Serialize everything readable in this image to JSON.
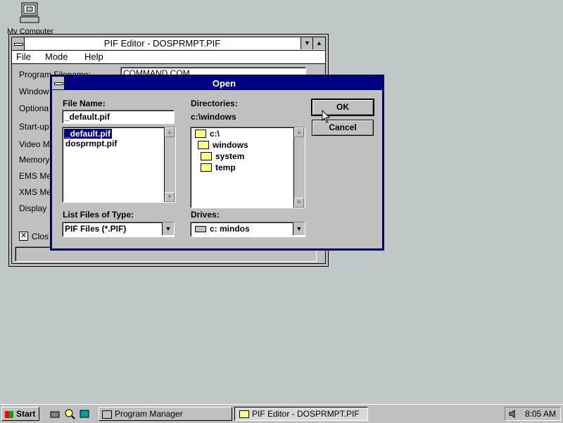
{
  "desktop": {
    "icon_label": "My Computer"
  },
  "pif_window": {
    "title": "PIF Editor - DOSPRMPT.PIF",
    "menu": [
      "File",
      "Mode",
      "Help"
    ],
    "fields": [
      {
        "label": "Program Filename:",
        "value": "COMMAND.COM"
      },
      {
        "label": "Window"
      },
      {
        "label": "Optiona"
      },
      {
        "label": "Start-up"
      },
      {
        "label": "Video M"
      },
      {
        "label": "Memory"
      },
      {
        "label": "EMS Me"
      },
      {
        "label": "XMS Me"
      },
      {
        "label": "Display"
      }
    ],
    "close_checkbox_label": "Clos"
  },
  "open_dialog": {
    "title": "Open",
    "file_name_label": "File Name:",
    "file_name_value": "_default.pif",
    "files": [
      "_default.pif",
      "dosprmpt.pif"
    ],
    "selected_file": "_default.pif",
    "directories_label": "Directories:",
    "current_dir": "c:\\windows",
    "dir_tree": [
      "c:\\",
      "windows",
      "system",
      "temp"
    ],
    "list_type_label": "List Files of Type:",
    "list_type_value": "PIF Files (*.PIF)",
    "drives_label": "Drives:",
    "drive_value": "c: mindos",
    "ok_label": "OK",
    "cancel_label": "Cancel"
  },
  "taskbar": {
    "start_label": "Start",
    "tasks": [
      "Program Manager",
      "PIF Editor - DOSPRMPT.PIF"
    ],
    "active_task": "PIF Editor - DOSPRMPT.PIF",
    "clock": "8:05 AM"
  }
}
